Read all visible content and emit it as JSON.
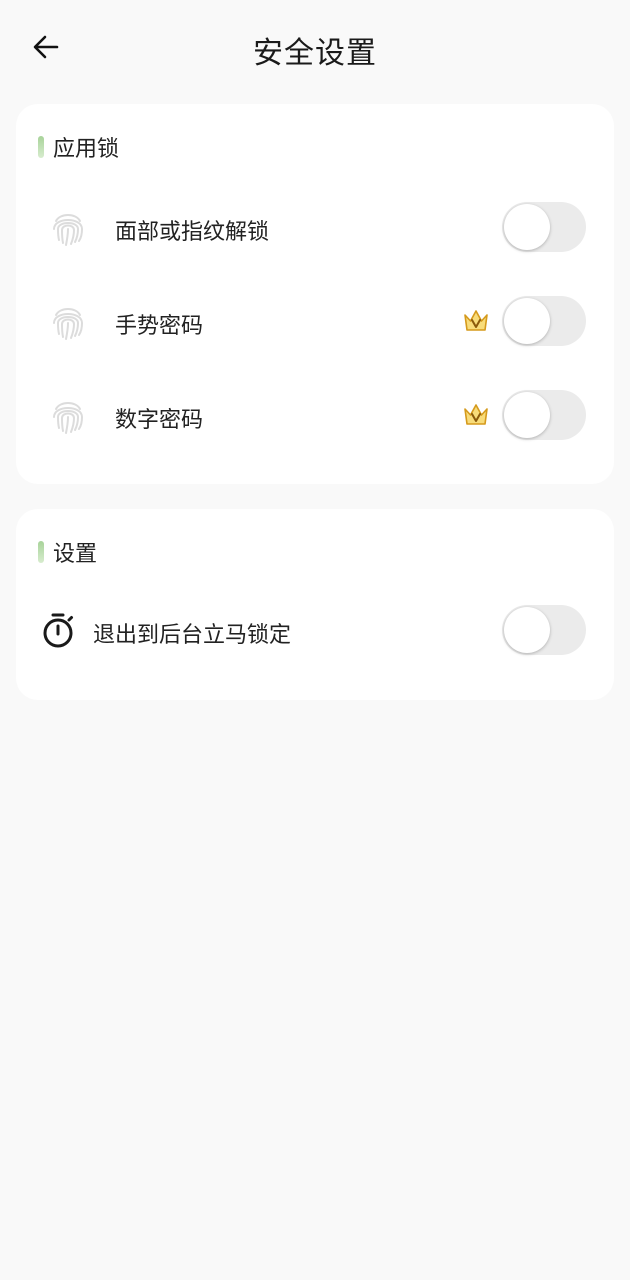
{
  "header": {
    "title": "安全设置"
  },
  "app_lock": {
    "title": "应用锁",
    "items": [
      {
        "label": "面部或指纹解锁",
        "icon": "fingerprint-icon",
        "vip": false,
        "enabled": false
      },
      {
        "label": "手势密码",
        "icon": "fingerprint-icon",
        "vip": true,
        "enabled": false
      },
      {
        "label": "数字密码",
        "icon": "fingerprint-icon",
        "vip": true,
        "enabled": false
      }
    ]
  },
  "settings": {
    "title": "设置",
    "items": [
      {
        "label": "退出到后台立马锁定",
        "icon": "timer-icon",
        "enabled": false
      }
    ]
  },
  "colors": {
    "background": "#f9f9f9",
    "card": "#ffffff",
    "accent_marker": "#a8d39a",
    "toggle_off": "#ebebeb",
    "vip_gold": "#f3c846"
  }
}
